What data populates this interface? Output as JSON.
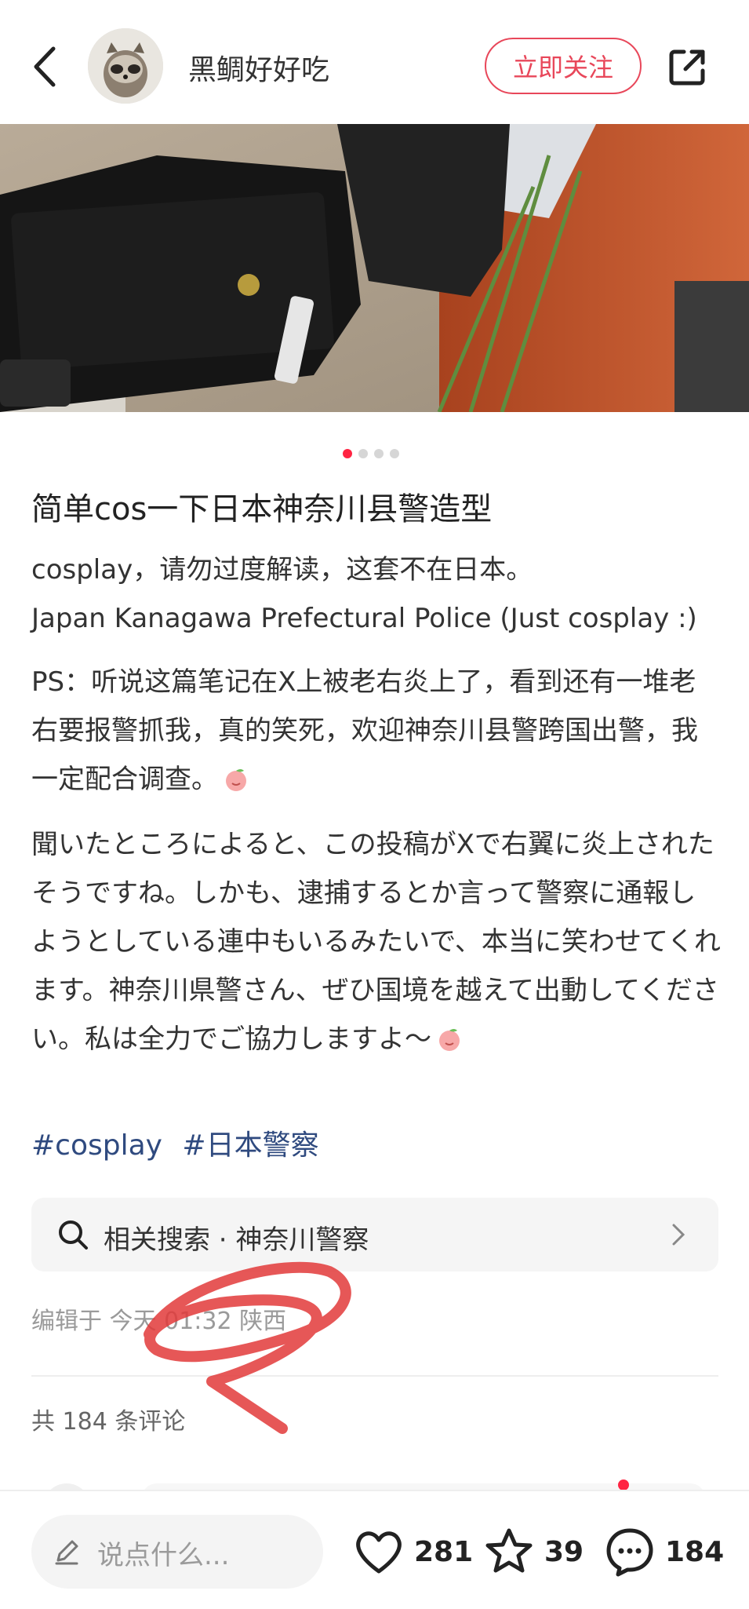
{
  "header": {
    "author_name": "黑鲷好好吃",
    "follow_label": "立即关注",
    "icons": [
      "back-arrow-icon",
      "share-icon"
    ]
  },
  "carousel": {
    "page_count": 4,
    "active_index": 0,
    "active_color": "#ff2442"
  },
  "post": {
    "title": "简单cos一下日本神奈川县警造型",
    "desc_line1": "cosplay，请勿过度解读，这套不在日本。",
    "desc_line2": "Japan Kanagawa Prefectural Police (Just cosplay :)",
    "ps": "PS：听说这篇笔记在X上被老右炎上了，看到还有一堆老右要报警抓我，真的笑死，欢迎神奈川县警跨国出警，我一定配合调查。",
    "jp": "聞いたところによると、この投稿がXで右翼に炎上されたそうですね。しかも、逮捕するとか言って警察に通報しようとしている連中もいるみたいで、本当に笑わせてくれます。神奈川県警さん、ぜひ国境を越えて出動してください。私は全力でご協力しますよ～",
    "tags": [
      "#cosplay",
      "#日本警察"
    ]
  },
  "related_search": {
    "label": "相关搜索 · 神奈川警察"
  },
  "meta": {
    "edited": "编辑于 今天 01:32 陕西"
  },
  "comments": {
    "count_label": "共 184 条评论"
  },
  "bottom_bar": {
    "compose_placeholder": "说点什么...",
    "likes": "281",
    "favorites": "39",
    "comments": "184"
  },
  "colors": {
    "accent": "#e8475a",
    "tag": "#2f4a7f",
    "scribble": "#e23a3a"
  }
}
